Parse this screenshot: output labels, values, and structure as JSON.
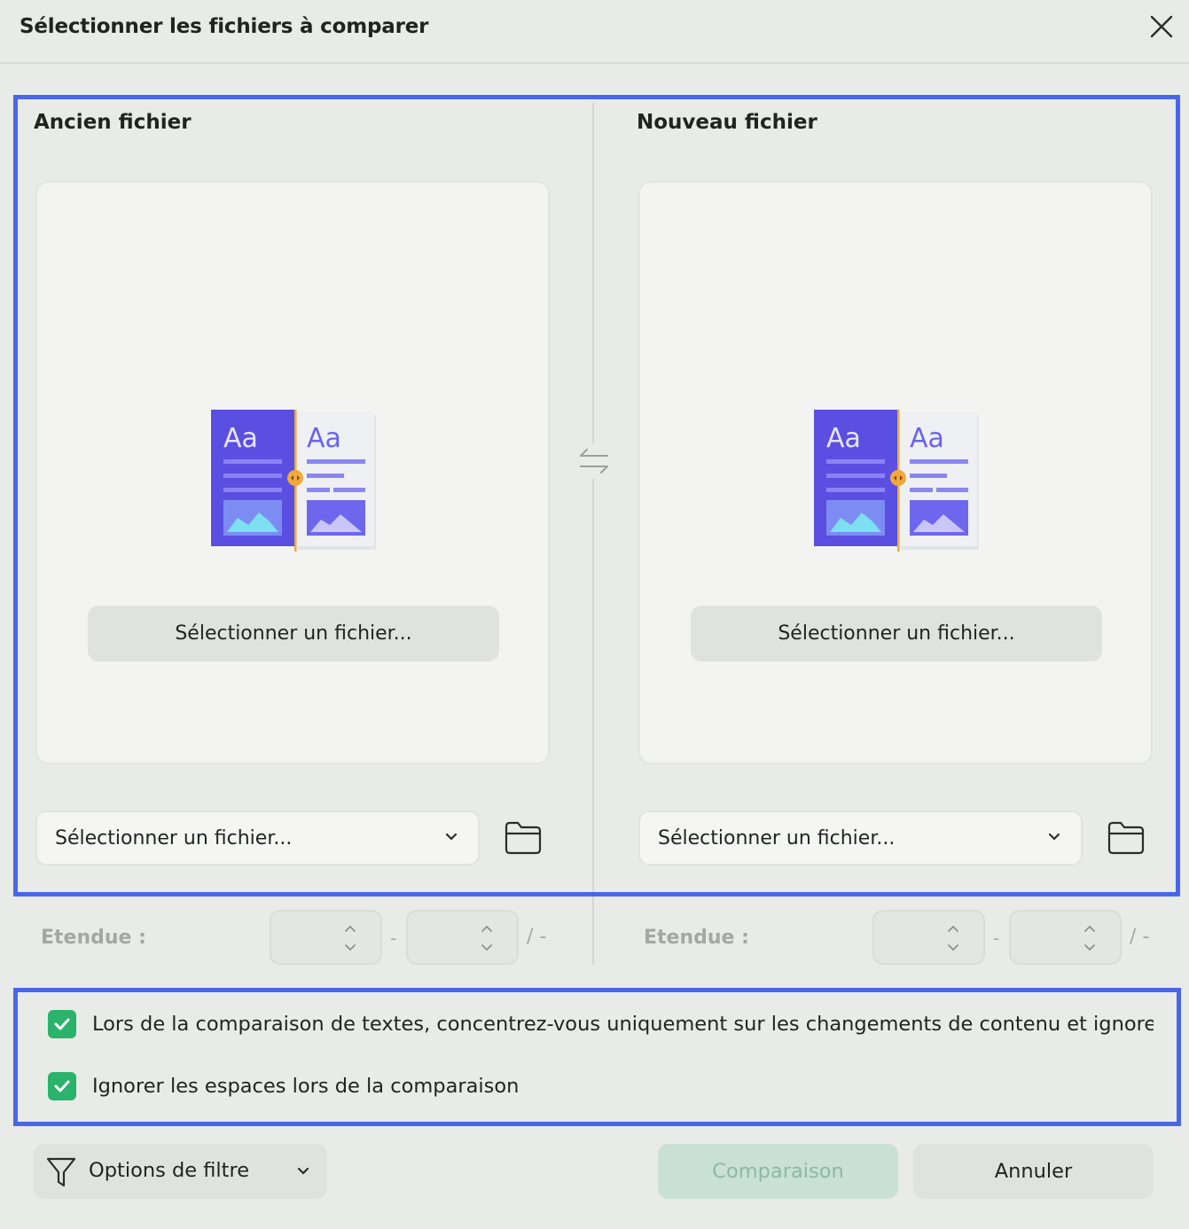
{
  "dialog": {
    "title": "Sélectionner les fichiers à comparer",
    "close_icon": "close-icon"
  },
  "old_file": {
    "title": "Ancien fichier",
    "drop_button": "Sélectionner un fichier...",
    "select_value": "Sélectionner un fichier...",
    "range_label": "Etendue :",
    "range_sep": "-",
    "range_of": "/ -"
  },
  "new_file": {
    "title": "Nouveau fichier",
    "drop_button": "Sélectionner un fichier...",
    "select_value": "Sélectionner un fichier...",
    "range_label": "Etendue :",
    "range_sep": "-",
    "range_of": "/ -"
  },
  "illustration": {
    "left_label": "Aa",
    "right_label": "Aa"
  },
  "options": [
    {
      "label": "Lors de la comparaison de textes, concentrez-vous uniquement sur les changements de contenu et ignorez les attr",
      "checked": true
    },
    {
      "label": "Ignorer les espaces lors de la comparaison",
      "checked": true
    }
  ],
  "footer": {
    "filter_label": "Options de filtre",
    "compare_label": "Comparaison",
    "cancel_label": "Annuler"
  },
  "colors": {
    "accent_highlight": "#4a66e8",
    "checkbox": "#2bb36b",
    "compare_disabled": "#c9e0d4"
  }
}
